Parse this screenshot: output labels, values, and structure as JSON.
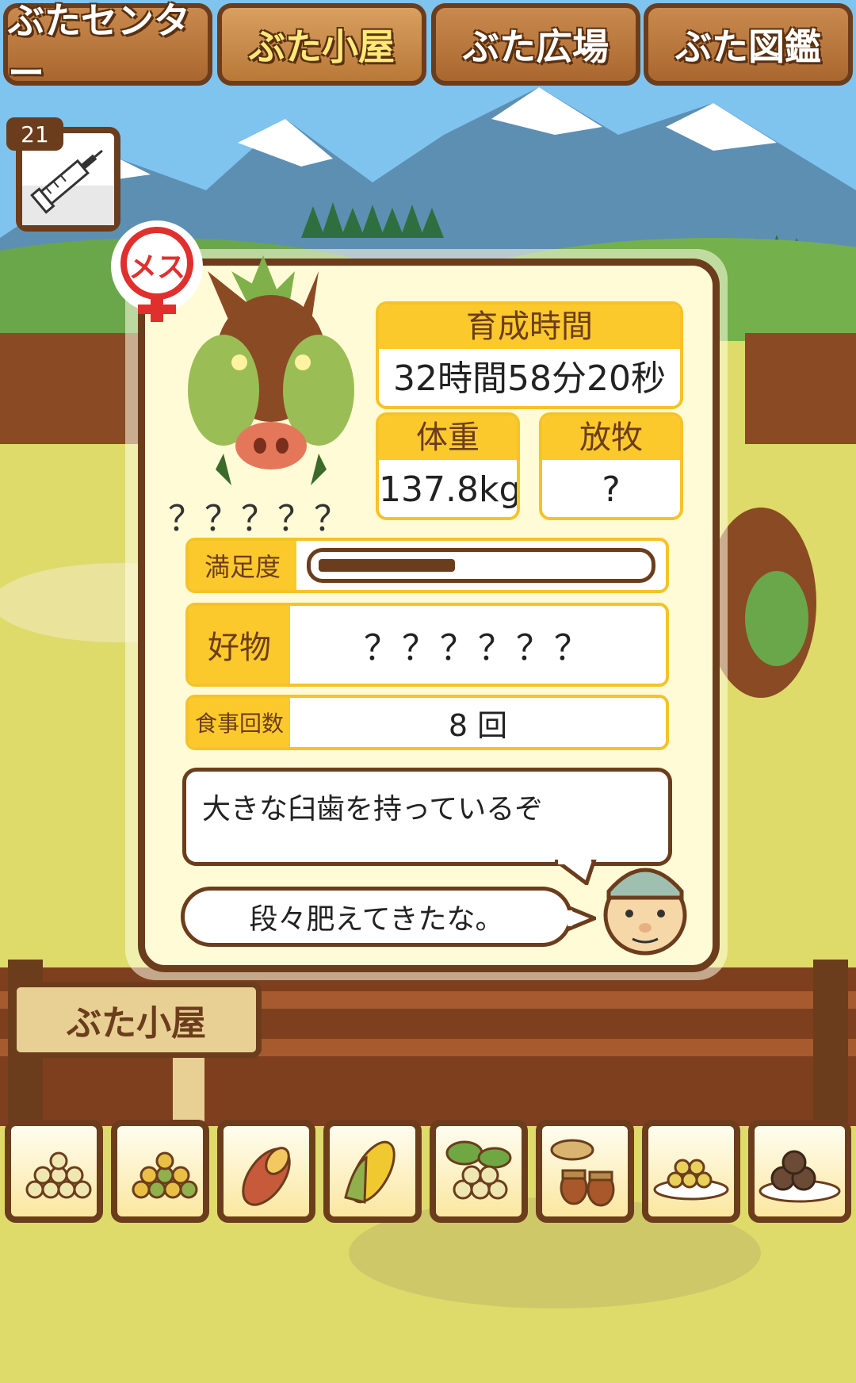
{
  "tabs": [
    {
      "label": "ぶたセンター"
    },
    {
      "label": "ぶた小屋"
    },
    {
      "label": "ぶた広場"
    },
    {
      "label": "ぶた図鑑"
    }
  ],
  "item": {
    "count": "21",
    "icon": "syringe-icon"
  },
  "gender": {
    "label": "メス"
  },
  "pig": {
    "name": "？？？？？"
  },
  "stats": {
    "raise_time_label": "育成時間",
    "raise_time": "32時間58分20秒",
    "weight_label": "体重",
    "weight": "137.8kg",
    "grazing_label": "放牧",
    "grazing": "?"
  },
  "satisfaction": {
    "label": "満足度",
    "level": 0.42
  },
  "favorite": {
    "label": "好物",
    "value": "？？？？？？"
  },
  "meals": {
    "label": "食事回数",
    "value": "8 回"
  },
  "description": "大きな臼歯を持っているぞ",
  "comment": "段々肥えてきたな。",
  "sign": "ぶた小屋",
  "foods": [
    {
      "name": "soybean-pile-icon"
    },
    {
      "name": "mixed-bean-pile-icon"
    },
    {
      "name": "sweet-potato-icon"
    },
    {
      "name": "corn-icon"
    },
    {
      "name": "vegetable-beans-icon"
    },
    {
      "name": "acorn-icon"
    },
    {
      "name": "bean-plate-icon"
    },
    {
      "name": "meatball-plate-icon"
    }
  ]
}
